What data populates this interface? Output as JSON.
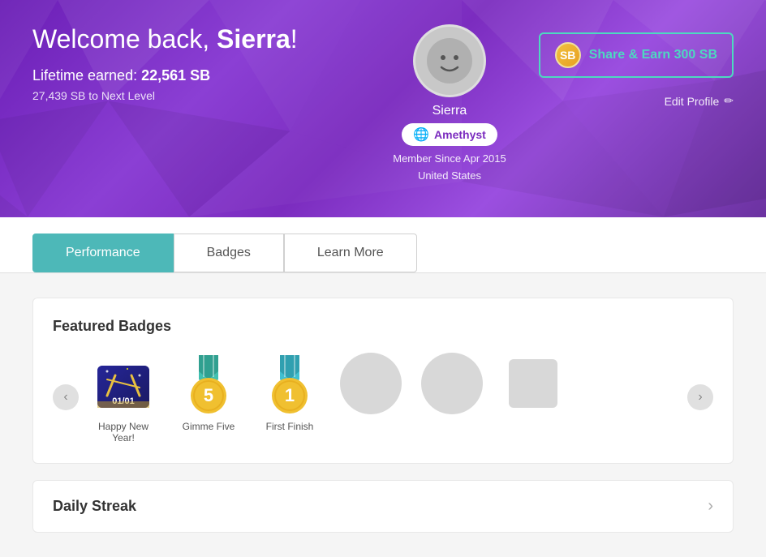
{
  "header": {
    "welcome_text": "Welcome back, Sierra!",
    "lifetime_label": "Lifetime earned:",
    "lifetime_amount": "22,561 SB",
    "next_level_text": "27,439 SB to Next Level",
    "username": "Sierra",
    "level_name": "Amethyst",
    "member_since": "Member Since Apr 2015",
    "country": "United States",
    "share_button_label": "Share & Earn 300 SB",
    "edit_profile_label": "Edit Profile"
  },
  "tabs": {
    "items": [
      {
        "label": "Performance",
        "active": true
      },
      {
        "label": "Badges",
        "active": false
      },
      {
        "label": "Learn More",
        "active": false
      }
    ]
  },
  "featured_badges": {
    "title": "Featured Badges",
    "badges": [
      {
        "name": "Happy New Year!",
        "type": "new_year"
      },
      {
        "name": "Gimme Five",
        "type": "five"
      },
      {
        "name": "First Finish",
        "type": "first"
      },
      {
        "name": "",
        "type": "empty"
      },
      {
        "name": "",
        "type": "empty"
      },
      {
        "name": "",
        "type": "empty"
      }
    ],
    "prev_label": "‹",
    "next_label": "›"
  },
  "daily_streak": {
    "title": "Daily Streak"
  }
}
